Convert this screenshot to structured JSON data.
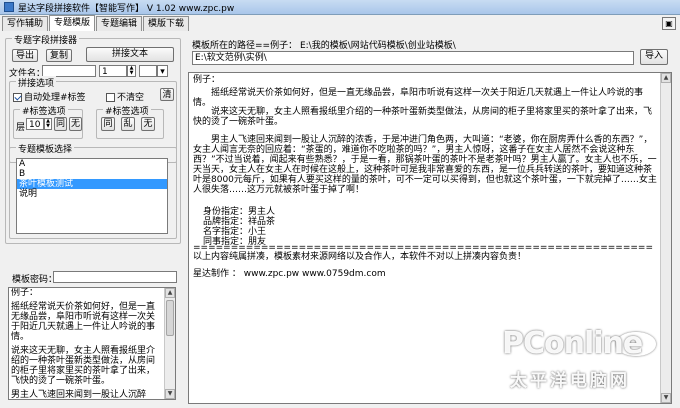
{
  "window": {
    "title": "星达字段拼接软件【智能写作】 V 1.02    www.zpc.pw",
    "buttons": [
      "—",
      "□",
      "×"
    ]
  },
  "tabs": [
    "写作辅助",
    "专题模版",
    "专题编辑",
    "模版下载"
  ],
  "left": {
    "group_main": "专题字段拼接器",
    "btn_export": "导出",
    "btn_copy": "复制",
    "btn_concat": "拼接文本",
    "filename_label": "文件名：",
    "filename_value": "",
    "num1": "1",
    "concat_options": "拼接选项",
    "auto_process": "自动处理#标签",
    "not_clear": "不清空",
    "clear_btn": "清",
    "tag_options1": "#标签选项",
    "tag_options2": "#标签选项",
    "layer_label": "层",
    "layer_value": "10",
    "same_btn": "同",
    "none_btn": "无",
    "same_btn2": "同",
    "mess_btn": "乱",
    "none_btn2": "无",
    "template_group": "专题模板选择",
    "template_items": [
      "A",
      "B",
      "茶叶模板测试",
      "说明"
    ],
    "template_selected": 2,
    "password_label": "模板密码：",
    "password_value": "",
    "example_label": "例子：",
    "example_lines": [
      "    摇纸经常说天价茶如何好，但是一直无缘品尝，阜阳市听说有这样一次关于阳近几天就遇上一件让人吟说的事情。",
      "    说来这天无聊，女主人照看报纸里介绍的一种茶叶蛋新类型做法，从房间的柜子里将家里买的茶叶拿了出来，飞快的烫了一碗茶叶蛋。",
      "    男主人飞速回来闻到一股让人沉醉"
    ]
  },
  "right": {
    "path_label": "模板所在的路径==例子： E:\\我的模板\\网站代码模板\\创业站模板\\",
    "path_value": "E:\\软文范例\\实例\\",
    "import_btn": "导入",
    "editor_lines": {
      "example": "例子：",
      "p1": "摇纸经常说天价茶如何好，但是一直无缘品尝，阜阳市听说有这样一次关于阳近几天就遇上一件让人吟说的事情。",
      "p2": "说来这天无聊，女主人照看报纸里介绍的一种茶叶蛋新类型做法，从房间的柜子里将家里买的茶叶拿了出来，飞快的烫了一碗茶叶蛋。",
      "p3": "男主人飞速回来闻到一股让人沉醉的浓香，于是冲进门角色两，大叫道：“老婆，你在厨房弄什么香的东西？”，女主人闻言无奈的回应着：“茶蛋的，难道你不吃啦茶的吗？”，男主人惊呀，这番子在女主人居然不会说这种东西？”不过当说着，闻起来有些熟悉？，于是一看，那锅茶叶蛋的茶叶不是老茶叶吗？男主人赢了。女主人也不乐，一天当天，女主人在女主人在时候在这般上，这种茶叶可是我非常喜爱的东西，是一位兵兵转送的茶叶，要知道这种茶叶是8000元每斤，如果有人要买这样的量的茶叶，可不一定可以买得到，但也就这个茶叶蛋，一下就完掉了……女主人很失落……这万元就被茶叶蛋于掉了啊！",
      "identity_lines": [
        "身份指定：男主人",
        "品牌指定：祥品茶",
        "名字指定：小王",
        "同事指定：朋友"
      ],
      "separator": "=============================================================",
      "footer": "以上内容纯属拼凑，模板素材来源网络以及合作人，本软件不对以上拼凑内容负责！",
      "credit": "星达制作 ：  www.zpc.pw     www.0759dm.com"
    }
  },
  "watermark": {
    "brand": "PConline",
    "cn": "太平洋电脑网"
  }
}
